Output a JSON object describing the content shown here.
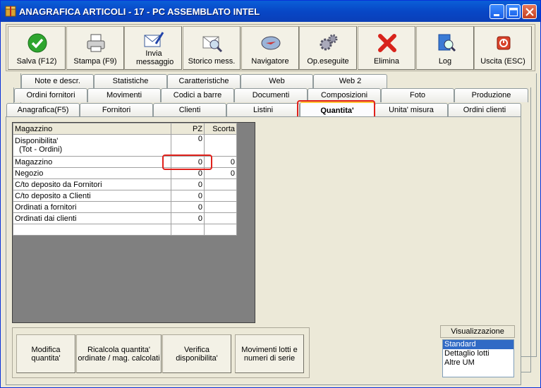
{
  "window": {
    "title": "ANAGRAFICA ARTICOLI - 17 - PC ASSEMBLATO INTEL"
  },
  "colors": {
    "titlebar": "#0847c6",
    "highlight": "#e0211b",
    "selection": "#316ac5"
  },
  "toolbar": {
    "buttons": [
      {
        "label": "Salva (F12)",
        "icon": "check-icon"
      },
      {
        "label": "Stampa (F9)",
        "icon": "printer-icon"
      },
      {
        "label": "Invia messaggio",
        "icon": "envelope-pen-icon"
      },
      {
        "label": "Storico mess.",
        "icon": "envelope-search-icon"
      },
      {
        "label": "Navigatore",
        "icon": "compass-icon"
      },
      {
        "label": "Op.eseguite",
        "icon": "gears-icon"
      },
      {
        "label": "Elimina",
        "icon": "red-x-icon"
      },
      {
        "label": "Log",
        "icon": "book-search-icon"
      },
      {
        "label": "Uscita (ESC)",
        "icon": "exit-icon"
      }
    ]
  },
  "tabs": {
    "row1": [
      "Note e descr.",
      "Statistiche",
      "Caratteristiche",
      "Web",
      "Web 2"
    ],
    "row2": [
      "Ordini fornitori",
      "Movimenti",
      "Codici a barre",
      "Documenti",
      "Composizioni",
      "Foto",
      "Produzione"
    ],
    "row3": [
      "Anagrafica(F5)",
      "Fornitori",
      "Clienti",
      "Listini",
      "Quantita'",
      "Unita' misura",
      "Ordini clienti"
    ],
    "active": "Quantita'"
  },
  "grid": {
    "headers": [
      "Magazzino",
      "PZ",
      "Scorta"
    ],
    "rows": [
      {
        "label": "Disponibilita'",
        "label2": "(Tot - Ordini)",
        "pz": "0",
        "scorta": ""
      },
      {
        "label": "Magazzino",
        "pz": "0",
        "scorta": "0"
      },
      {
        "label": "Negozio",
        "pz": "0",
        "scorta": "0"
      },
      {
        "label": "C/to deposito da Fornitori",
        "pz": "0",
        "scorta": ""
      },
      {
        "label": "C/to deposito a Clienti",
        "pz": "0",
        "scorta": ""
      },
      {
        "label": "Ordinati a fornitori",
        "pz": "0",
        "scorta": ""
      },
      {
        "label": "Ordinati dai clienti",
        "pz": "0",
        "scorta": ""
      },
      {
        "label": "",
        "pz": "",
        "scorta": ""
      }
    ]
  },
  "actions": [
    "Modifica quantita'",
    "Ricalcola quantita' ordinate / mag. calcolati",
    "Verifica disponibilita'",
    "Movimenti lotti e numeri di serie"
  ],
  "visualizzazione": {
    "label": "Visualizzazione",
    "options": [
      "Standard",
      "Dettaglio lotti",
      "Altre UM"
    ],
    "selected": "Standard"
  }
}
